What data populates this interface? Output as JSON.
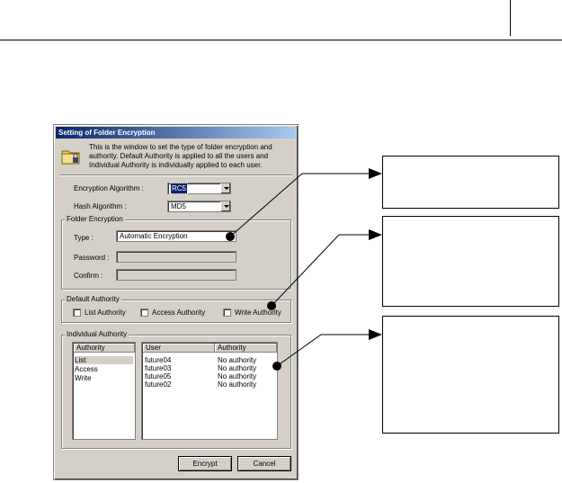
{
  "dialog": {
    "title": "Setting of Folder Encryption",
    "info_text": "This is the window to set the type of folder encryption and authority.  Default Authority is applied to all the users and Individual Authority is individually applied to each user.",
    "encryption_algorithm": {
      "label": "Encryption Algorithm :",
      "value": "RC5"
    },
    "hash_algorithm": {
      "label": "Hash Algorithm :",
      "value": "MD5"
    },
    "folder_encryption": {
      "title": "Folder Encryption",
      "type_label": "Type :",
      "type_value": "Automatic Encryption",
      "password_label": "Password :",
      "confirm_label": "Confirm :"
    },
    "default_authority": {
      "title": "Default Authority",
      "list_label": "List Authority",
      "access_label": "Access Authority",
      "write_label": "Write Authority"
    },
    "individual_authority": {
      "title": "Individual Authority",
      "left_header": "Authority",
      "left_items": [
        "List",
        "Access",
        "Write"
      ],
      "user_header": "User",
      "auth_header": "Authority",
      "rows": [
        {
          "user": "future04",
          "authority": "No authority"
        },
        {
          "user": "future03",
          "authority": "No authority"
        },
        {
          "user": "future05",
          "authority": "No authority"
        },
        {
          "user": "future02",
          "authority": "No authority"
        }
      ]
    },
    "encrypt_button": "Encrypt",
    "cancel_button": "Cancel"
  }
}
